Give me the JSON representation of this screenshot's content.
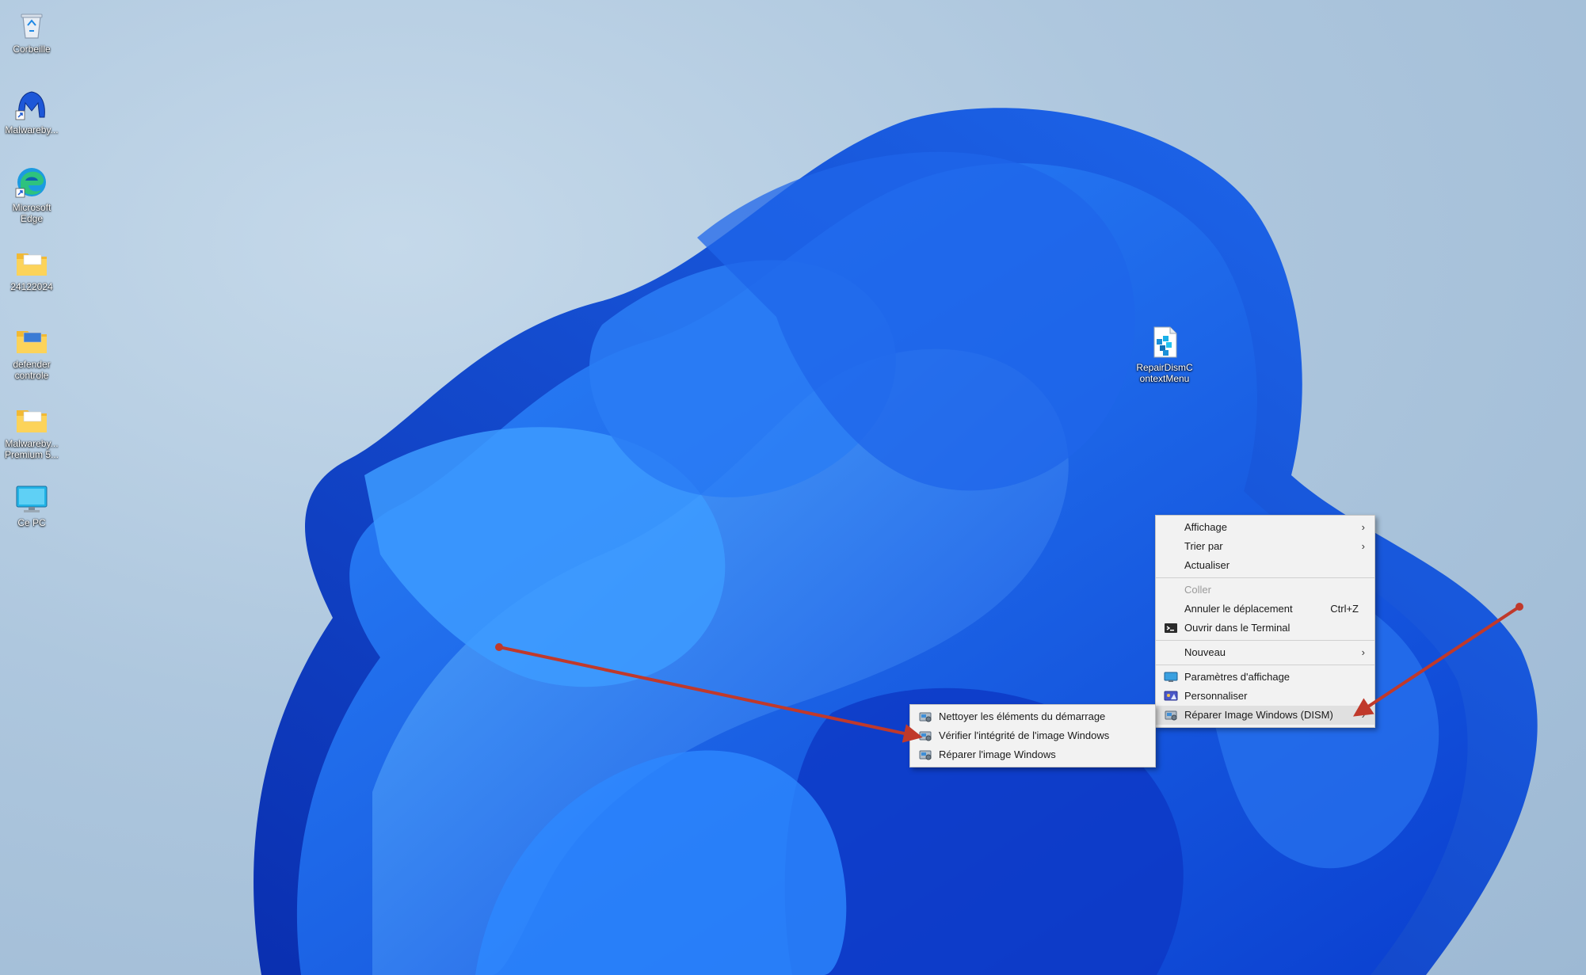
{
  "desktop_icons": [
    {
      "label": "Corbeille",
      "icon": "recycle-bin-icon"
    },
    {
      "label": "Malwareby...",
      "icon": "malwarebytes-icon"
    },
    {
      "label": "Microsoft\nEdge",
      "icon": "edge-icon"
    },
    {
      "label": "24122024",
      "icon": "folder-icon"
    },
    {
      "label": "defender\ncontrole",
      "icon": "folder-icon"
    },
    {
      "label": "Malwareby...\nPremium 5...",
      "icon": "folder-icon"
    },
    {
      "label": "Ce PC",
      "icon": "monitor-icon"
    },
    {
      "label": "RepairDismC\nontextMenu",
      "icon": "registry-file-icon"
    }
  ],
  "context_menu": {
    "items": [
      {
        "label": "Affichage",
        "submenu": true
      },
      {
        "label": "Trier par",
        "submenu": true
      },
      {
        "label": "Actualiser"
      },
      {
        "label": "Coller",
        "disabled": true
      },
      {
        "label": "Annuler le déplacement",
        "shortcut": "Ctrl+Z"
      },
      {
        "label": "Ouvrir dans le Terminal",
        "icon": "terminal-icon"
      },
      {
        "label": "Nouveau",
        "submenu": true
      },
      {
        "label": "Paramètres d'affichage",
        "icon": "display-settings-icon"
      },
      {
        "label": "Personnaliser",
        "icon": "personalize-icon"
      },
      {
        "label": "Réparer Image Windows (DISM)",
        "icon": "dism-tool-icon",
        "submenu": true,
        "highlighted": true
      }
    ]
  },
  "submenu": {
    "items": [
      {
        "label": "Nettoyer les éléments du démarrage",
        "icon": "dism-tool-icon"
      },
      {
        "label": "Vérifier l'intégrité de l'image Windows",
        "icon": "dism-tool-icon"
      },
      {
        "label": "Réparer l'image Windows",
        "icon": "dism-tool-icon"
      }
    ]
  },
  "colors": {
    "annotation_arrow": "#c0392b",
    "menu_bg": "#f2f2f2",
    "highlight": "#e0e0e0"
  }
}
